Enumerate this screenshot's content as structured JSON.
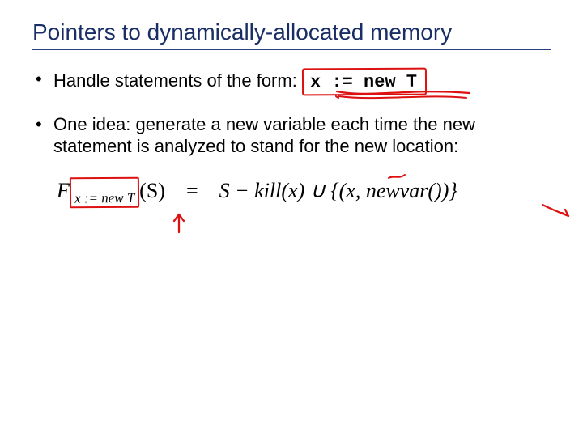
{
  "title": "Pointers to dynamically-allocated memory",
  "bullet1": {
    "text_before": "Handle statements of the form: ",
    "code": "x := new T"
  },
  "bullet2": "One idea: generate a new variable each time the new statement is analyzed to stand for the new location:",
  "formula": {
    "F": "F",
    "sub": "x := new T",
    "arg": "(S)",
    "eq": " = ",
    "rhs1": "S − kill(x) ∪ {(x, newvar())}"
  },
  "annotation_color": "#d11"
}
